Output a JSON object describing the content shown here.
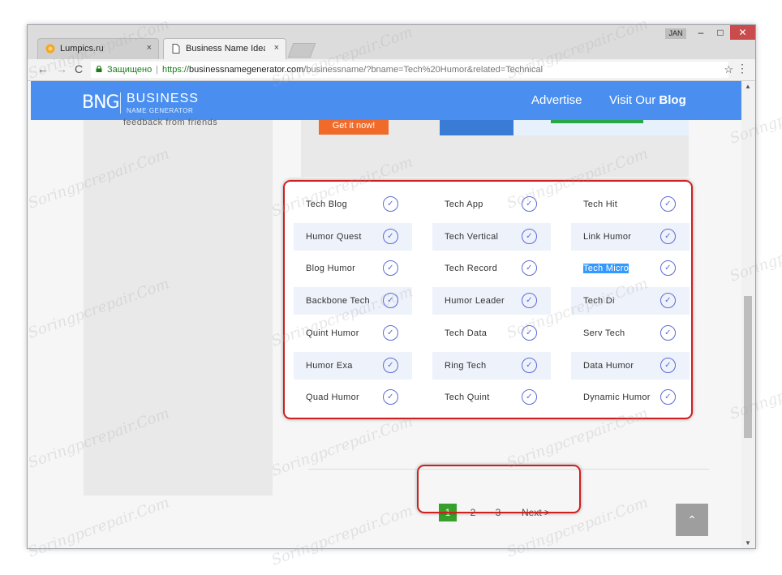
{
  "browser": {
    "tabs": [
      {
        "title": "Lumpics.ru",
        "close": "×"
      },
      {
        "title": "Business Name Ideas - Fl",
        "close": "×"
      }
    ],
    "user_label": "JAN",
    "window_controls": {
      "minimize": "–",
      "maximize": "□",
      "close": "✕"
    },
    "nav": {
      "back": "←",
      "forward": "→",
      "reload": "C"
    },
    "security_label": "Защищено",
    "url_prefix": "https://",
    "url_domain": "businessnamegenerator.com",
    "url_path": "/businessname/?bname=Tech%20Humor&related=Technical",
    "star": "☆",
    "menu": "⋮"
  },
  "site": {
    "logo_mark": "BNG",
    "logo_title": "BUSINESS",
    "logo_subtitle": "NAME GENERATOR",
    "nav": {
      "advertise": "Advertise",
      "visit_prefix": "Visit Our ",
      "blog": "Blog"
    },
    "accent_color": "#4a8ff0"
  },
  "sidebar": {
    "feedback_text": "feedback from friends"
  },
  "ad": {
    "get_it_label": "Get it now!"
  },
  "results": {
    "names": [
      "Tech Blog",
      "Tech App",
      "Tech Hit",
      "Humor Quest",
      "Tech Vertical",
      "Link Humor",
      "Blog Humor",
      "Tech Record",
      "Tech Micro",
      "Backbone Tech",
      "Humor Leader",
      "Tech Di",
      "Quint Humor",
      "Tech Data",
      "Serv Tech",
      "Humor Exa",
      "Ring Tech",
      "Data Humor",
      "Quad Humor",
      "Tech Quint",
      "Dynamic Humor"
    ],
    "selected_name": "Tech Micro",
    "check_icon": "✓"
  },
  "pagination": {
    "pages": [
      "1",
      "2",
      "3"
    ],
    "active_page": "1",
    "next_label": "Next >"
  },
  "back_to_top": "⌃",
  "watermark": "Soringpcrepair.Com"
}
